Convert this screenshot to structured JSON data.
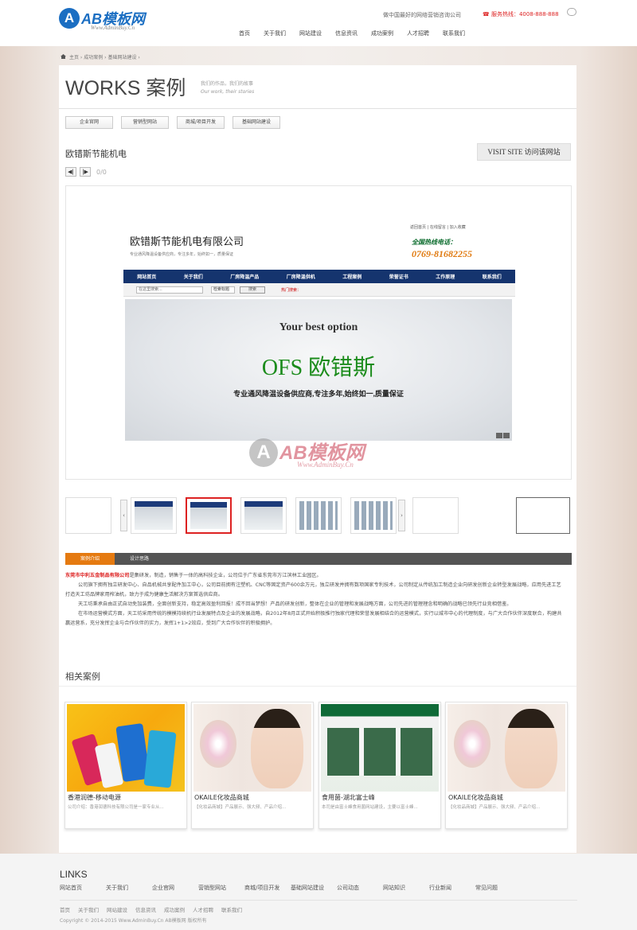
{
  "header": {
    "logo_text": "AB模板网",
    "logo_sub": "Www.AdminBuy.Cn",
    "slogan": "做中国最好的网络营销咨询公司",
    "hotline_label": "服务热线：",
    "hotline": "4008-888-888",
    "nav": [
      "首页",
      "关于我们",
      "网站建设",
      "信息资讯",
      "成功案例",
      "人才招聘",
      "联系我们"
    ]
  },
  "breadcrumb": {
    "home": "主页",
    "sep1": " › ",
    "c1": "成功案例",
    "sep2": " › ",
    "c2": "基础网站建设",
    "sep3": " ›"
  },
  "works": {
    "title": "WORKS 案例",
    "sub1": "我们的作品，我们的故事",
    "sub2": "Our work, their stories"
  },
  "tabs": [
    "企业官网",
    "营销型网站",
    "商城/项目开发",
    "基础网站建设"
  ],
  "project": {
    "title": "欧错斯节能机电",
    "visit": "VISIT SITE 访问该网站",
    "prev": "◀|",
    "next": "|▶",
    "counter": "0/0"
  },
  "screenshot": {
    "company": "欧错斯节能机电有限公司",
    "desc": "专业通风降温设备供应商，专注多年，始终如一，质量保证",
    "top_links": "返回首页 | 在线留言 | 加入收藏",
    "hot": "全国热线电话：",
    "tel": "0769-81682255",
    "nav": [
      "网站首页",
      "关于我们",
      "厂房降温产品",
      "厂房降温供机",
      "工程案例",
      "荣誉证书",
      "工作原理",
      "联系我们"
    ],
    "search_placeholder": "在这里搜索...",
    "search_select": "检索标题",
    "search_btn": "搜索",
    "hot_kw": "热门搜索：",
    "banner1": "Your best option",
    "banner2": "OFS 欧错斯",
    "banner3": "专业通风降温设备供应商,专注多年,始终如一,质量保证"
  },
  "watermark": {
    "text": "AB模板网",
    "sub": "Www.AdminBuy.Cn"
  },
  "info_tabs": [
    "案例介绍",
    "设计思路"
  ],
  "body": {
    "lead": "东莞市中利五金制品有限公司",
    "p1": "是集研发，制造，销售于一体的高科技企业，公司位于广东省东莞市万江滨林工业园区。",
    "p2": "公司旗下拥有独立研发中心、自品机械共享配件加工中心，公司目前拥有注塑机、CNC等固定资产600余万元，独立研发并拥有数项国家专利技术，公司制定从传统加工制造企业向研发创新企业转型发展战略，应用先进工艺打造天工坊品牌家用榨油机，致力于成为健康生活解决方案首选供应商。",
    "p3": "天工坊秉承自由正式自动免加装费，全面创新支持，稳定高效盈利回报！成不回当梦想！产品的研发创新，整体在企业的管理和发展战略方面，公司先进的管理理念和明确的战略已领先行业竞相借鉴。",
    "p4": "在市场运营模式方面，天工坊采用传统的模模持续机行业发展特点及企业的发展战略，自2012年8月正式开始积极推行独家代理和荣誉发展相结合的运营模式，实行以城市中心的代理制度，与广大合作伙伴深度联合，构建共赢运营系，充分发挥企业与合作伙伴的实力，发挥1+1>2效应，受到广大合作伙伴的积极拥护。"
  },
  "related": {
    "title": "相关案例",
    "cards": [
      {
        "title": "香港润德-移动电源",
        "desc": "公司介绍：香港润德科技有限公司是一家专业从..."
      },
      {
        "title": "OKAILE化妆品商城",
        "desc": "【化妆品商城】产品展示、强大频、产品介绍..."
      },
      {
        "title": "食用菌-湖北富士峰",
        "desc": "本司是由富士峰食用菌网站建设，主要以富士峰..."
      },
      {
        "title": "OKAILE化妆品商城",
        "desc": "【化妆品商城】产品展示、强大频、产品介绍..."
      }
    ]
  },
  "footer": {
    "title": "LINKS",
    "links": [
      "网站首页",
      "关于我们",
      "企业官网",
      "营销型网站",
      "商城/项目开发",
      "基础网站建设",
      "公司动态",
      "网站知识",
      "行业新闻",
      "常见问题"
    ],
    "nav": [
      "首页",
      "关于我们",
      "网站建设",
      "信息资讯",
      "成功案例",
      "人才招聘",
      "联系我们"
    ],
    "copyright": "Copyright © 2014-2015 Www.AdminBuy.Cn AB模板网 版权所有"
  },
  "colors": {
    "brand": "#1b6ec2",
    "accent": "#e57a10",
    "alert": "#dd2222"
  }
}
